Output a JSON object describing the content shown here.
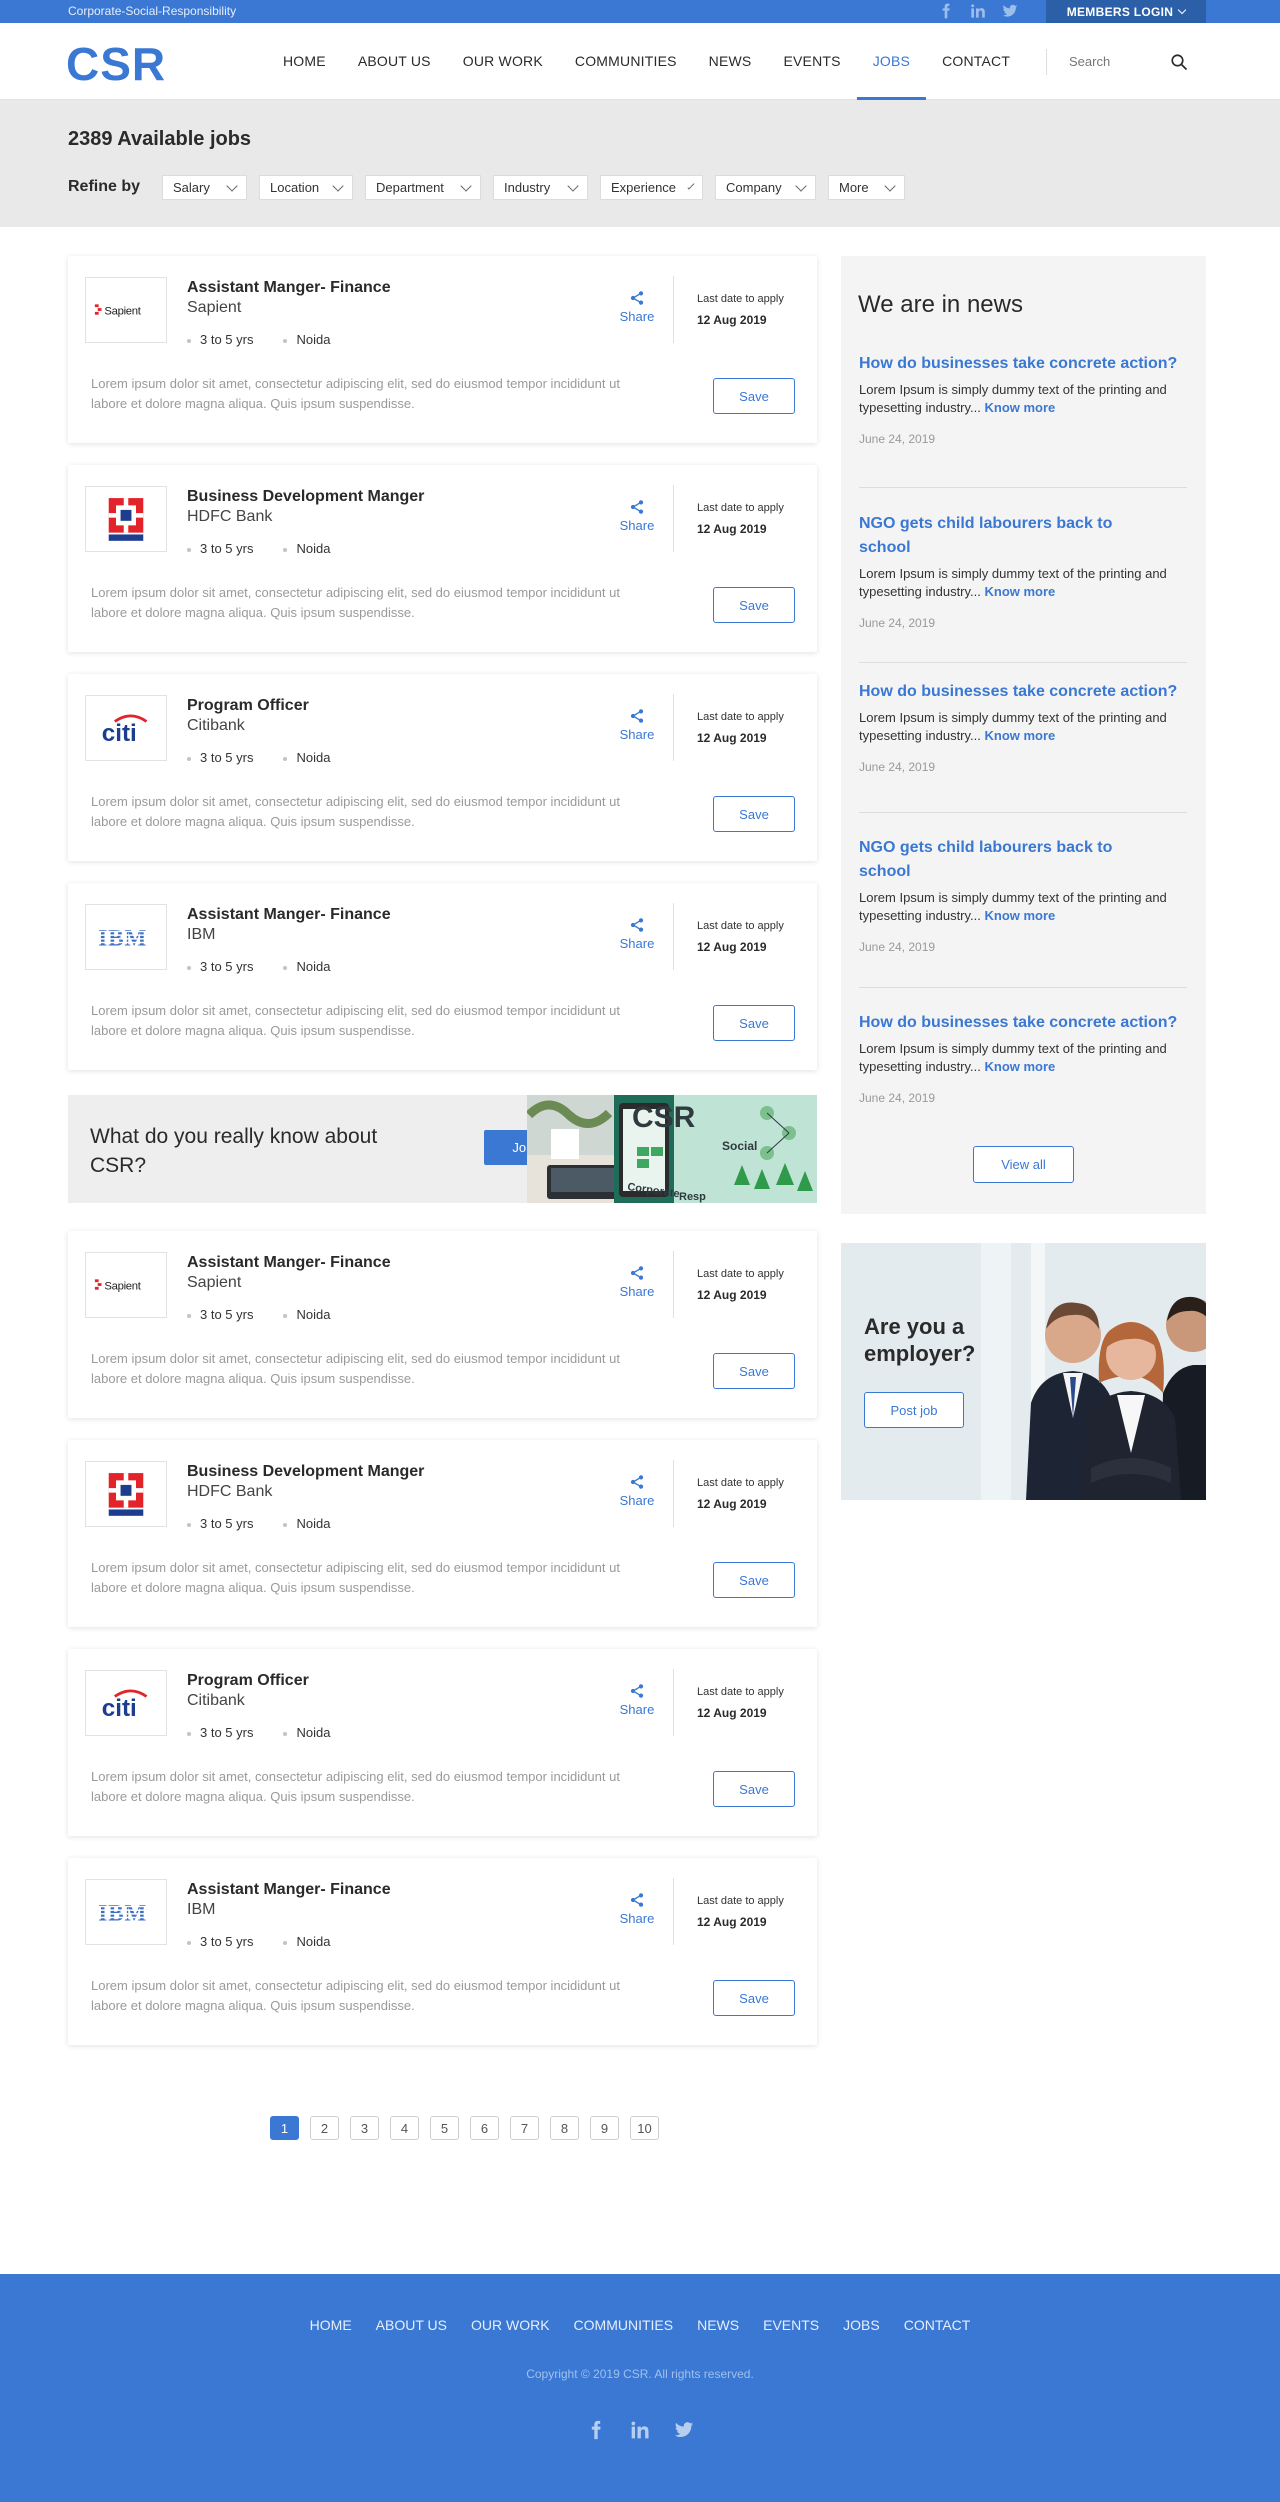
{
  "topbar": {
    "tagline": "Corporate-Social-Responsibility",
    "members_login": "MEMBERS LOGIN",
    "social_icons": [
      "facebook-icon",
      "linkedin-icon",
      "twitter-icon"
    ]
  },
  "header": {
    "logo": "CSR",
    "nav": [
      "HOME",
      "ABOUT US",
      "OUR WORK",
      "COMMUNITIES",
      "NEWS",
      "EVENTS",
      "JOBS",
      "CONTACT"
    ],
    "active_nav": "JOBS",
    "search_placeholder": "Search"
  },
  "jobs_header": {
    "title": "2389 Available jobs",
    "refine_label": "Refine by",
    "filters": [
      "Salary",
      "Location",
      "Department",
      "Industry",
      "Experience",
      "Company",
      "More"
    ]
  },
  "jobs": [
    {
      "title": "Assistant Manger- Finance",
      "company": "Sapient",
      "experience": "3 to 5 yrs",
      "location": "Noida",
      "share": "Share",
      "last_label": "Last date to apply",
      "last_date": "12 Aug 2019",
      "desc": "Lorem ipsum dolor sit amet, consectetur adipiscing elit, sed do eiusmod tempor incididunt ut labore et dolore magna aliqua. Quis ipsum suspendisse.",
      "save": "Save"
    },
    {
      "title": "Business Development Manger",
      "company": "HDFC Bank",
      "experience": "3 to 5 yrs",
      "location": "Noida",
      "share": "Share",
      "last_label": "Last date to apply",
      "last_date": "12 Aug 2019",
      "desc": "Lorem ipsum dolor sit amet, consectetur adipiscing elit, sed do eiusmod tempor incididunt ut labore et dolore magna aliqua. Quis ipsum suspendisse.",
      "save": "Save"
    },
    {
      "title": "Program Officer",
      "company": "Citibank",
      "experience": "3 to 5 yrs",
      "location": "Noida",
      "share": "Share",
      "last_label": "Last date to apply",
      "last_date": "12 Aug 2019",
      "desc": "Lorem ipsum dolor sit amet, consectetur adipiscing elit, sed do eiusmod tempor incididunt ut labore et dolore magna aliqua. Quis ipsum suspendisse.",
      "save": "Save"
    },
    {
      "title": "Assistant Manger- Finance",
      "company": "IBM",
      "experience": "3 to 5 yrs",
      "location": "Noida",
      "share": "Share",
      "last_label": "Last date to apply",
      "last_date": "12 Aug 2019",
      "desc": "Lorem ipsum dolor sit amet, consectetur adipiscing elit, sed do eiusmod tempor incididunt ut labore et dolore magna aliqua. Quis ipsum suspendisse.",
      "save": "Save"
    },
    {
      "title": "Assistant Manger- Finance",
      "company": "Sapient",
      "experience": "3 to 5 yrs",
      "location": "Noida",
      "share": "Share",
      "last_label": "Last date to apply",
      "last_date": "12 Aug 2019",
      "desc": "Lorem ipsum dolor sit amet, consectetur adipiscing elit, sed do eiusmod tempor incididunt ut labore et dolore magna aliqua. Quis ipsum suspendisse.",
      "save": "Save"
    },
    {
      "title": "Business Development Manger",
      "company": "HDFC Bank",
      "experience": "3 to 5 yrs",
      "location": "Noida",
      "share": "Share",
      "last_label": "Last date to apply",
      "last_date": "12 Aug 2019",
      "desc": "Lorem ipsum dolor sit amet, consectetur adipiscing elit, sed do eiusmod tempor incididunt ut labore et dolore magna aliqua. Quis ipsum suspendisse.",
      "save": "Save"
    },
    {
      "title": "Program Officer",
      "company": "Citibank",
      "experience": "3 to 5 yrs",
      "location": "Noida",
      "share": "Share",
      "last_label": "Last date to apply",
      "last_date": "12 Aug 2019",
      "desc": "Lorem ipsum dolor sit amet, consectetur adipiscing elit, sed do eiusmod tempor incididunt ut labore et dolore magna aliqua. Quis ipsum suspendisse.",
      "save": "Save"
    },
    {
      "title": "Assistant Manger- Finance",
      "company": "IBM",
      "experience": "3 to 5 yrs",
      "location": "Noida",
      "share": "Share",
      "last_label": "Last date to apply",
      "last_date": "12 Aug 2019",
      "desc": "Lorem ipsum dolor sit amet, consectetur adipiscing elit, sed do eiusmod tempor incididunt ut labore et dolore magna aliqua. Quis ipsum suspendisse.",
      "save": "Save"
    }
  ],
  "promo": {
    "question": "What do you really know about CSR?",
    "button": "Join us",
    "image_text": [
      "CSR",
      "Social",
      "Corporate",
      "Resp"
    ]
  },
  "news": {
    "heading": "We are in news",
    "items": [
      {
        "title": "How do businesses take concrete action?",
        "desc": "Lorem Ipsum is simply dummy text of the printing and typesetting industry...",
        "more": "Know more",
        "date": "June 24, 2019"
      },
      {
        "title": "NGO gets child labourers back to school",
        "desc": "Lorem Ipsum is simply dummy text of the printing and typesetting industry...",
        "more": "Know more",
        "date": "June 24, 2019"
      },
      {
        "title": "How do businesses take concrete action?",
        "desc": "Lorem Ipsum is simply dummy text of the printing and typesetting industry...",
        "more": "Know more",
        "date": "June 24, 2019"
      },
      {
        "title": "NGO gets child labourers back to school",
        "desc": "Lorem Ipsum is simply dummy text of the printing and typesetting industry...",
        "more": "Know more",
        "date": "June 24, 2019"
      },
      {
        "title": "How do businesses take concrete action?",
        "desc": "Lorem Ipsum is simply dummy text of the printing and typesetting industry...",
        "more": "Know more",
        "date": "June 24, 2019"
      }
    ],
    "view_all": "View all"
  },
  "employer": {
    "question": "Are you a employer?",
    "button": "Post job"
  },
  "pagination": {
    "pages": [
      "1",
      "2",
      "3",
      "4",
      "5",
      "6",
      "7",
      "8",
      "9",
      "10"
    ],
    "current": "1"
  },
  "footer": {
    "nav": [
      "HOME",
      "ABOUT US",
      "OUR WORK",
      "COMMUNITIES",
      "NEWS",
      "EVENTS",
      "JOBS",
      "CONTACT"
    ],
    "copyright": "Copyright © 2019 CSR. All rights reserved."
  },
  "colors": {
    "brand": "#3a78d3",
    "brand_dark": "#2b5fa8",
    "band_bg": "#e9e9e9",
    "sidebar_bg": "#f4f4f4"
  }
}
